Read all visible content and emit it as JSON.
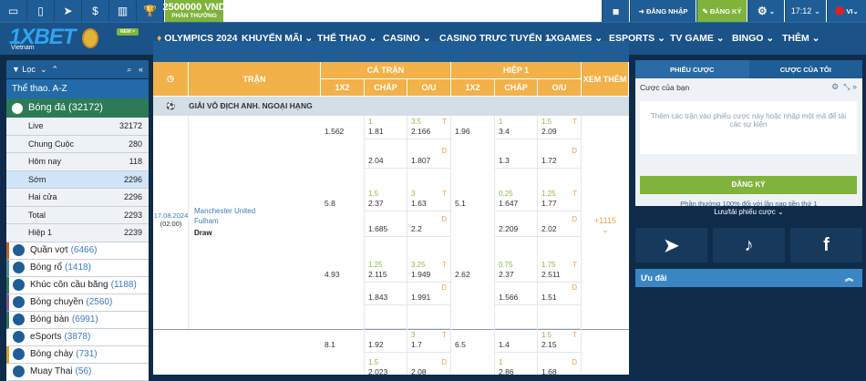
{
  "topbar": {
    "icons": [
      "desktop-icon",
      "mobile-icon",
      "telegram-icon",
      "dollar-icon",
      "stats-icon",
      "trophy-icon"
    ],
    "bonus_amount": "2500000 VND",
    "bonus_label": "PHẦN THƯỞNG",
    "login": "ĐĂNG NHẬP",
    "register": "ĐĂNG KÝ",
    "time": "17:12",
    "lang": "VI"
  },
  "nav": {
    "logo": "1XBET",
    "logo_sub": "Vietnam",
    "new_badge": "NEW >",
    "items": [
      "OLYMPICS 2024",
      "KHUYẾN MÃI",
      "THỂ THAO",
      "CASINO",
      "CASINO TRỰC TUYẾN",
      "1XGAMES",
      "ESPORTS",
      "TV GAME",
      "BINGO",
      "THÊM"
    ]
  },
  "sidebar": {
    "filter": "Lọc",
    "az": "Thể thao. A-Z",
    "football": "Bóng đá (32172)",
    "subs": [
      {
        "label": "Live",
        "count": "32172"
      },
      {
        "label": "Chung Cuộc",
        "count": "280"
      },
      {
        "label": "Hôm nay",
        "count": "118"
      },
      {
        "label": "Sớm",
        "count": "2296",
        "active": true
      },
      {
        "label": "Hai cửa",
        "count": "2296"
      },
      {
        "label": "Total",
        "count": "2293"
      },
      {
        "label": "Hiệp 1",
        "count": "2239"
      }
    ],
    "sports": [
      {
        "label": "Quần vợt",
        "count": "(6466)",
        "color": "#c0622a"
      },
      {
        "label": "Bóng rổ",
        "count": "(1418)",
        "color": "#4e8fa3"
      },
      {
        "label": "Khúc côn cầu băng",
        "count": "(1188)",
        "color": "#2c7a57"
      },
      {
        "label": "Bóng chuyền",
        "count": "(2560)",
        "color": "#7a5aa0"
      },
      {
        "label": "Bóng bàn",
        "count": "(6991)",
        "color": "#2c7a57"
      },
      {
        "label": "eSports",
        "count": "(3878)",
        "color": "#ffffff"
      },
      {
        "label": "Bóng chày",
        "count": "(731)",
        "color": "#d6a521"
      },
      {
        "label": "Muay Thai",
        "count": "(56)",
        "color": "#ffffff"
      }
    ]
  },
  "table": {
    "match_col": "TRẬN",
    "full": "CÁ TRẬN",
    "half": "HIỆP 1",
    "more": "XEM THÊM",
    "subcols": [
      "1X2",
      "CHẤP",
      "O/U",
      "1X2",
      "CHẤP",
      "O/U"
    ],
    "league": "GIẢI VÔ ĐỊCH ANH. NGOẠI HẠNG",
    "match": {
      "date": "17.08.2024",
      "time": "(02:00)",
      "home": "Manchester United",
      "away": "Fulham",
      "draw": "Draw",
      "more": "+1115"
    },
    "rows": [
      [
        {
          "v": "1.562"
        },
        {
          "p": "1",
          "v": "1.81"
        },
        {
          "p": "3.5",
          "t": "T",
          "v": "2.166"
        },
        {
          "v": "1.96"
        },
        {
          "p": "1",
          "v": "3.4"
        },
        {
          "p": "1.5",
          "t": "T",
          "v": "2.09"
        }
      ],
      [
        {},
        {
          "v": "2.04"
        },
        {
          "t": "D",
          "v": "1.807"
        },
        {},
        {
          "v": "1.3"
        },
        {
          "t": "D",
          "v": "1.72"
        }
      ],
      [
        {
          "v": "5.8"
        },
        {
          "p": "1.5",
          "v": "2.37"
        },
        {
          "p": "3",
          "t": "T",
          "v": "1.63"
        },
        {
          "v": "5.1"
        },
        {
          "p": "0.25",
          "v": "1.647"
        },
        {
          "p": "1.25",
          "t": "T",
          "v": "1.77"
        }
      ],
      [
        {},
        {
          "v": "1.685"
        },
        {
          "t": "D",
          "v": "2.2"
        },
        {},
        {
          "v": "2.209"
        },
        {
          "t": "D",
          "v": "2.02"
        }
      ],
      [
        {
          "v": "4.93"
        },
        {
          "p": "1.25",
          "v": "2.115"
        },
        {
          "p": "3.25",
          "t": "T",
          "v": "1.949"
        },
        {
          "v": "2.62"
        },
        {
          "p": "0.75",
          "v": "2.37"
        },
        {
          "p": "1.75",
          "t": "T",
          "v": "2.511"
        }
      ],
      [
        {},
        {
          "v": "1.843"
        },
        {
          "t": "D",
          "v": "1.991"
        },
        {},
        {
          "v": "1.566"
        },
        {
          "t": "D",
          "v": "1.51"
        }
      ],
      [
        {},
        {},
        {},
        {},
        {},
        {}
      ],
      [
        {
          "v": "8.1"
        },
        {
          "v": "1.92"
        },
        {
          "p": "3",
          "t": "T",
          "v": "1.7"
        },
        {
          "v": "6.5"
        },
        {
          "v": "1.4"
        },
        {
          "p": "1.5",
          "t": "T",
          "v": "2.15"
        }
      ],
      [
        {},
        {
          "p": "1.5",
          "v": "2.023"
        },
        {
          "t": "D",
          "v": "2.08"
        },
        {},
        {
          "p": "1",
          "v": "2.86"
        },
        {
          "t": "D",
          "v": "1.68"
        }
      ]
    ]
  },
  "betslip": {
    "tab1": "PHIẾU CƯỢC",
    "tab2": "CƯỢC CỦA TÔI",
    "your_bets": "Cược của bạn",
    "empty": "Thêm các trận vào phiếu cược này hoặc nhập một mã để tải các sự kiện",
    "register": "ĐĂNG KÝ",
    "bonus": "Phần thưởng 100% đối với lần nạp tiền thứ 1",
    "save": "Lưu/tải phiếu cược",
    "promo": "Ưu đãi"
  },
  "colors": {
    "accent_orange": "#f3b149",
    "green": "#7fb33b",
    "blue": "#1f5d96",
    "navy": "#0e2c4a"
  }
}
